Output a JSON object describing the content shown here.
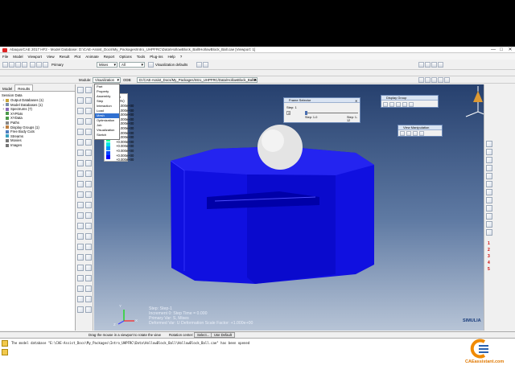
{
  "window": {
    "title": "Abaqus/CAE 2017 HF2 - Model Database: D:\\CAE-Assist_Docs\\My_Packages\\Intro_UHPFRC\\Data\\HollowBlock_Ball\\HollowBlock_Ball.cae [Viewport: 1]",
    "minimize": "—",
    "maximize": "□",
    "close": "✕"
  },
  "menu": [
    "File",
    "Model",
    "Viewport",
    "View",
    "Result",
    "Plot",
    "Animate",
    "Report",
    "Options",
    "Tools",
    "Plug-ins",
    "Help",
    "?"
  ],
  "toolbar": {
    "primary_label": "Primary",
    "variable_combo": "Mises",
    "field_combo": "All",
    "viz_defaults": "Visualization defaults"
  },
  "contextbar": {
    "module_label": "Module:",
    "module_value": "Visualization",
    "odb_label": "ODB:",
    "odb_path": "D:/CAE-Assist_Docs/My_Packages/Intro_UHPFRC/Data/HollowBlock_Ball/Job-7.odb"
  },
  "tabs": [
    "Model",
    "Results"
  ],
  "tree": {
    "header": "Session Data",
    "items": [
      {
        "label": "Output Databases (1)",
        "toggle": "+",
        "color": "#c9a43a"
      },
      {
        "label": "Model Databases (1)",
        "toggle": "+",
        "color": "#7a8fa8"
      },
      {
        "label": "Spectrums (7)",
        "toggle": "+",
        "color": "#8b6bb8"
      },
      {
        "label": "XYPlots",
        "toggle": "",
        "color": "#4b9a4b"
      },
      {
        "label": "XYData",
        "toggle": "",
        "color": "#4b9a4b"
      },
      {
        "label": "Paths",
        "toggle": "",
        "color": "#888888"
      },
      {
        "label": "Display Groups (1)",
        "toggle": "+",
        "color": "#c08040"
      },
      {
        "label": "Free Body Cuts",
        "toggle": "",
        "color": "#4d7fc0"
      },
      {
        "label": "Streams",
        "toggle": "",
        "color": "#3aa0c0"
      },
      {
        "label": "Movies",
        "toggle": "",
        "color": "#777777"
      },
      {
        "label": "Images",
        "toggle": "",
        "color": "#777777"
      }
    ]
  },
  "module_dropdown": [
    "Part",
    "Property",
    "Assembly",
    "Step",
    "Interaction",
    "Load",
    "Mesh",
    "Optimization",
    "Job",
    "Visualization",
    "Sketch"
  ],
  "module_dropdown_selected": "Mesh",
  "legend": {
    "title": "S, Mises",
    "subtitle": "(Avg: 75%)",
    "values": [
      "+0.000e+00",
      "+0.000e+00",
      "+0.000e+00",
      "+0.000e+00",
      "+0.000e+00",
      "+0.000e+00",
      "+0.000e+00",
      "+0.000e+00",
      "+0.000e+00",
      "+0.000e+00",
      "+0.000e+00",
      "+0.000e+00",
      "+0.000e+00"
    ],
    "colors": [
      "#ff0000",
      "#ff5a00",
      "#ffaa00",
      "#ffe600",
      "#c8ff00",
      "#6eff00",
      "#00ff1e",
      "#00ff8c",
      "#00e6e6",
      "#0096ff",
      "#0046ff",
      "#0000ff"
    ]
  },
  "frame_selector": {
    "title": "Frame Selector",
    "step_label": "Step: 1",
    "frame_left": "Step: 1-0",
    "frame_right": "Step: 1-12",
    "value": "0"
  },
  "display_group": {
    "title": "Display Group"
  },
  "view_manipulation": {
    "title": "View Manipulation"
  },
  "viewport_info": {
    "line1": "Step: Step-1",
    "line2": "Increment     0:  Step Time =       0.000",
    "line3": "Primary Var: S, Mises",
    "line4": "Deformed Var: U   Deformation Scale Factor: +1.000e+00"
  },
  "triad": {
    "x": "X",
    "y": "Y",
    "z": "Z"
  },
  "brand": "SIMULIA",
  "status": {
    "prompt": "Drag the mouse in a viewport to rotate the view",
    "rotation_center_label": "Rotation center:",
    "select_button": "Select...",
    "default_button": "Use Default"
  },
  "right_numbers": [
    "1",
    "2",
    "3",
    "4",
    "5"
  ],
  "message": "The model database \"E:\\CAE-Assist_Docs\\My_Packages\\Intro_UHPFRC\\Data\\HollowBlock_Ball\\HollowBlock_Ball.cae\" has been opened",
  "watermark": "CAEassistant.com"
}
